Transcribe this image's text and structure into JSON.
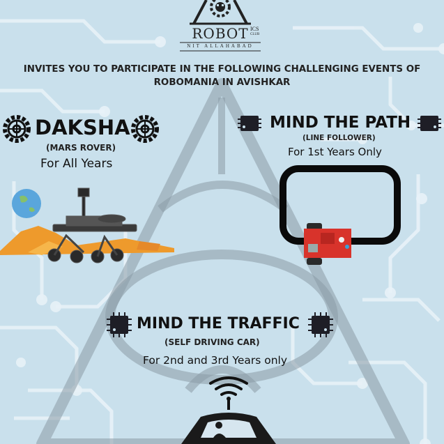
{
  "logo": {
    "main": "ROBOT",
    "suffix_top": "ICS",
    "suffix_bottom": "CLUB",
    "subtitle": "NIT ALLAHABAD",
    "icon": "gear-robot-icon"
  },
  "invite": {
    "line1": "INVITES YOU TO PARTICIPATE IN THE FOLLOWING CHALLENGING EVENTS OF",
    "line2": "ROBOMANIA IN  AVISHKAR"
  },
  "events": {
    "daksha": {
      "title": "DAKSHA",
      "subtitle": "(MARS ROVER)",
      "eligibility": "For All Years",
      "icon": "gear-icon",
      "illustration": "mars-rover-illustration"
    },
    "mind_the_path": {
      "title": "MIND THE PATH",
      "subtitle": "(LINE FOLLOWER)",
      "eligibility": "For 1st Years Only",
      "icon": "chip-icon",
      "illustration": "line-follower-illustration"
    },
    "mind_the_traffic": {
      "title": "MIND THE TRAFFIC",
      "subtitle": "(SELF DRIVING CAR)",
      "eligibility": "For 2nd and 3rd Years only",
      "icon": "chip-icon",
      "illustration": "self-driving-car-illustration"
    }
  },
  "colors": {
    "background": "#c9e0ec",
    "circuit": "#e6f1f7",
    "pyramid": "#9eaab3",
    "mars_orange": "#ee9a2c",
    "robot_red": "#d8332b"
  }
}
